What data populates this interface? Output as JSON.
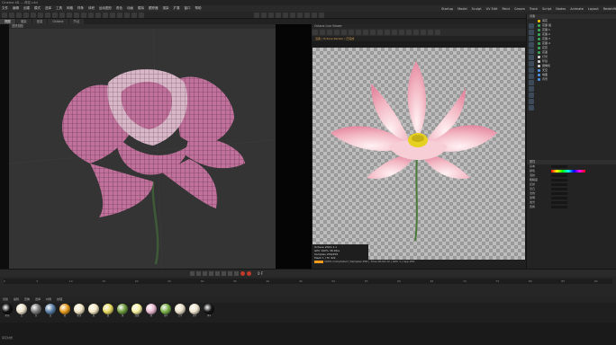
{
  "window": {
    "title": "Cinema 4D — 荷花.c4d",
    "status_text": "荷花材质"
  },
  "menu": {
    "items": [
      "文件",
      "编辑",
      "创建",
      "模式",
      "选择",
      "工具",
      "网格",
      "样条",
      "体积",
      "运动图形",
      "角色",
      "动画",
      "模拟",
      "跟踪器",
      "渲染",
      "扩展",
      "窗口",
      "帮助"
    ],
    "right_items": [
      "Startup",
      "Model",
      "Sculpt",
      "UV Edit",
      "Paint",
      "Groom",
      "Track",
      "Script",
      "Nodes",
      "Animate",
      "Layout",
      "Redshift"
    ]
  },
  "tabs": [
    "视图",
    "渲染",
    "信息",
    "Octane",
    "节点"
  ],
  "viewport": {
    "label": "透视视图",
    "camera": "默认摄像机"
  },
  "preview": {
    "title": "Octane Live Viewer",
    "subtitle": "渲染 / Octane Render / 已完成",
    "info_lines": [
      "Octane 2022.1.1",
      "GPU 100% 38.2fps",
      "Samples 256/256",
      "Mesh 1 / Tri 42k",
      "VRAM 1.8GB"
    ],
    "status": "100% Completed | Samples 256 | Time 00:00:12 | GPU 1 | Spp 256"
  },
  "object_manager": {
    "title": "对象",
    "items": [
      {
        "name": "荷花",
        "color": "#f0c000"
      },
      {
        "name": "花瓣 组",
        "color": "#3ba55c"
      },
      {
        "name": "花瓣.1",
        "color": "#3ba55c"
      },
      {
        "name": "花瓣.2",
        "color": "#3ba55c"
      },
      {
        "name": "花瓣.3",
        "color": "#3ba55c"
      },
      {
        "name": "花瓣.4",
        "color": "#3ba55c"
      },
      {
        "name": "花蕊",
        "color": "#3ba55c"
      },
      {
        "name": "花茎",
        "color": "#3ba55c"
      },
      {
        "name": "灯光",
        "color": "#d0d0d0"
      },
      {
        "name": "环境",
        "color": "#d0d0d0"
      },
      {
        "name": "摄像机",
        "color": "#d0d0d0"
      },
      {
        "name": "天空",
        "color": "#4a90e2"
      },
      {
        "name": "地面",
        "color": "#4a90e2"
      },
      {
        "name": "背景",
        "color": "#4a90e2"
      }
    ]
  },
  "attributes": {
    "title": "属性",
    "rows": [
      "基本",
      "颜色",
      "漫射",
      "粗糙度",
      "反射",
      "凹凸",
      "法线",
      "透明",
      "发光",
      "置换"
    ]
  },
  "timeline": {
    "start": "0 F",
    "end": "90 F",
    "current": "0 F",
    "ticks": [
      "0",
      "5",
      "10",
      "15",
      "20",
      "25",
      "30",
      "35",
      "40",
      "45",
      "50",
      "55",
      "60",
      "65",
      "70",
      "75",
      "80",
      "85",
      "90"
    ]
  },
  "materials": {
    "header": [
      "创建",
      "编辑",
      "查看",
      "选择",
      "材质",
      "纹理"
    ],
    "items": [
      {
        "name": "黑色",
        "color": "#111111"
      },
      {
        "name": "白",
        "color": "#e8e0c8"
      },
      {
        "name": "灰",
        "color": "#7a7a7a"
      },
      {
        "name": "蓝",
        "color": "#5a7fa8"
      },
      {
        "name": "橙",
        "color": "#e69a1e"
      },
      {
        "name": "象牙",
        "color": "#efe4c2"
      },
      {
        "name": "米",
        "color": "#f2e6c0"
      },
      {
        "name": "黄",
        "color": "#e6d960"
      },
      {
        "name": "绿",
        "color": "#6b9a3c"
      },
      {
        "name": "浅黄",
        "color": "#f5f0a0"
      },
      {
        "name": "粉",
        "color": "#e8b8d0"
      },
      {
        "name": "绿2",
        "color": "#7ab04a"
      },
      {
        "name": "白2",
        "color": "#e8e0c8"
      },
      {
        "name": "米2",
        "color": "#ece2cc"
      },
      {
        "name": "黑2",
        "color": "#151515"
      }
    ]
  }
}
